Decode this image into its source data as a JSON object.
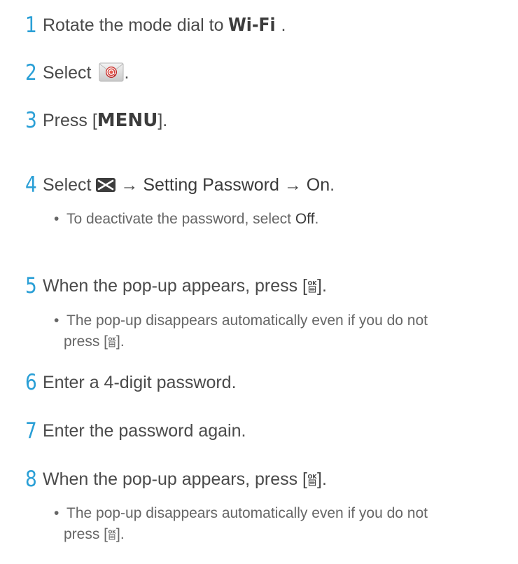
{
  "steps": [
    {
      "num": "1",
      "pre": "Rotate the mode dial to ",
      "highlight": "Wi-Fi",
      "post": "."
    },
    {
      "num": "2",
      "pre": "Select ",
      "post": "."
    },
    {
      "num": "3",
      "pre": "Press [",
      "highlight": "MENU",
      "post": "]."
    },
    {
      "num": "4",
      "pre": "Select ",
      "arrow1": " → ",
      "b1": "Setting Password",
      "arrow2": " → ",
      "b2": "On",
      "post": "."
    },
    {
      "num": "5",
      "pre": "When the pop-up appears, press [",
      "post": "]."
    },
    {
      "num": "6",
      "text": "Enter a 4-digit password."
    },
    {
      "num": "7",
      "text": "Enter the password again."
    },
    {
      "num": "8",
      "pre": "When the pop-up appears, press [",
      "post": "]."
    }
  ],
  "notes": {
    "n4": {
      "pre": "To deactivate the password, select ",
      "b": "Off",
      "post": "."
    },
    "n5": {
      "line1": "The pop-up disappears automatically even if you do not",
      "line2pre": "press [",
      "line2post": "]."
    },
    "n8": {
      "line1": "The pop-up disappears automatically even if you do not",
      "line2pre": "press [",
      "line2post": "]."
    }
  },
  "icons": {
    "email": "email-sharing-icon",
    "message": "message-envelope-icon",
    "ok": "ok-delete-button-icon"
  },
  "colors": {
    "step_number": "#2a9fd6",
    "text": "#4a4a4a",
    "note_text": "#666666",
    "email_icon_red": "#c8282a"
  }
}
